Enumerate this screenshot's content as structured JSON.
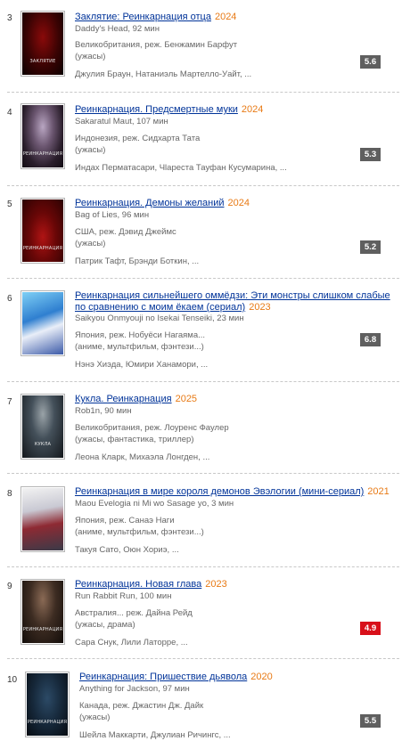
{
  "items": [
    {
      "num": "3",
      "title": "Заклятие: Реинкарнация отца",
      "year": "2024",
      "original": "Daddy's Head, 92 мин",
      "country_director": "Великобритания, реж. Бенжамин Барфут",
      "genres": "(ужасы)",
      "cast": "Джулия Браун, Натаниэль Мартелло-Уайт, ...",
      "rating": "5.6",
      "poster_caption": "ЗАКЛЯТИЕ"
    },
    {
      "num": "4",
      "title": "Реинкарнация. Предсмертные муки",
      "year": "2024",
      "original": "Sakaratul Maut, 107 мин",
      "country_director": "Индонезия, реж. Сидхарта Тата",
      "genres": "(ужасы)",
      "cast": "Индах Перматасари, Чlaреста Тауфан Кусумарина, ...",
      "rating": "5.3",
      "poster_caption": "РЕИНКАРНАЦИЯ"
    },
    {
      "num": "5",
      "title": "Реинкарнация. Демоны желаний",
      "year": "2024",
      "original": "Bag of Lies, 96 мин",
      "country_director": "США, реж. Дэвид Джеймс",
      "genres": "(ужасы)",
      "cast": "Патрик Тафт, Брэнди Боткин, ...",
      "rating": "5.2",
      "poster_caption": "РЕИНКАРНАЦИЯ"
    },
    {
      "num": "6",
      "title": "Реинкарнация сильнейшего оммёдзи: Эти монстры слишком слабые по сравнению с моим ёкаем (сериал)",
      "year": "2023",
      "original": "Saikyou Onmyouji no Isekai Tenseiki, 23 мин",
      "country_director": "Япония, реж. Нобуёси Нагаяма...",
      "genres": "(аниме, мультфильм, фэнтези...)",
      "cast": "Нэнэ Хиэда, Юмири Ханамори, ...",
      "rating": "6.8",
      "poster_caption": ""
    },
    {
      "num": "7",
      "title": "Кукла. Реинкарнация",
      "year": "2025",
      "original": "Rob1n, 90 мин",
      "country_director": "Великобритания, реж. Лоуренс Фаулер",
      "genres": "(ужасы, фантастика, триллер)",
      "cast": "Леона Кларк, Михаэла Лонгден, ...",
      "rating": "",
      "poster_caption": "КУКЛА"
    },
    {
      "num": "8",
      "title": "Реинкарнация в мире короля демонов Эвэлогии (мини-сериал)",
      "year": "2021",
      "original": "Maou Evelogia ni Mi wo Sasage yo, 3 мин",
      "country_director": "Япония, реж. Санаэ Наги",
      "genres": "(аниме, мультфильм, фэнтези...)",
      "cast": "Такуя Сато, Оюн Хориэ, ...",
      "rating": "",
      "poster_caption": ""
    },
    {
      "num": "9",
      "title": "Реинкарнация. Новая глава",
      "year": "2023",
      "original": "Run Rabbit Run, 100 мин",
      "country_director": "Австралия... реж. Дайна Рейд",
      "genres": "(ужасы, драма)",
      "cast": "Сара Снук, Лили Латорре, ...",
      "rating": "4.9",
      "poster_caption": "РЕИНКАРНАЦИЯ"
    },
    {
      "num": "10",
      "title": "Реинкарнация: Пришествие дьявола",
      "year": "2020",
      "original": "Anything for Jackson, 97 мин",
      "country_director": "Канада, реж. Джастин Дж. Дайк",
      "genres": "(ужасы)",
      "cast": "Шейла Маккарти, Джулиан Ричингс, ...",
      "rating": "5.5",
      "poster_caption": "РЕИНКАРНАЦИЯ"
    }
  ]
}
